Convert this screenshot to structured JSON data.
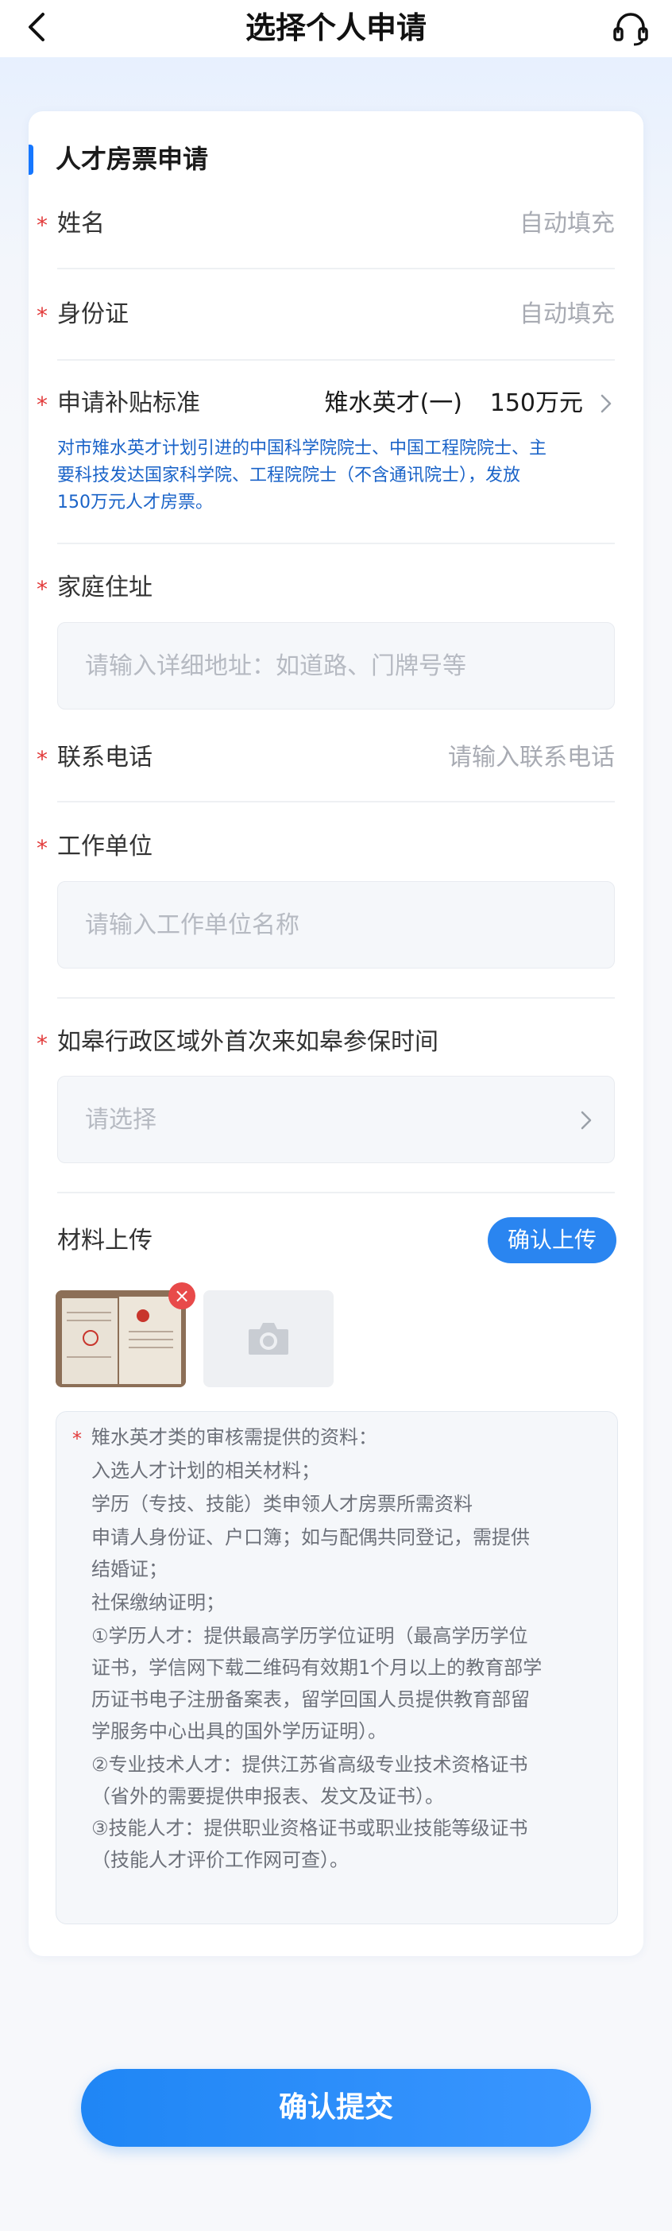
{
  "header": {
    "title": "选择个人申请",
    "back_icon": "back-chevron-icon",
    "support_icon": "headset-icon"
  },
  "form": {
    "section_title": "人才房票申请",
    "required_mark": "*",
    "name": {
      "label": "姓名",
      "value": "自动填充"
    },
    "id_card": {
      "label": "身份证",
      "value": "自动填充"
    },
    "subsidy": {
      "label": "申请补贴标准",
      "value": "雉水英才(一)",
      "amount": "150万元",
      "description_lines": [
        "对市雉水英才计划引进的中国科学院院士、中国工程院院士、主",
        "要科技发达国家科学院、工程院院士（不含通讯院士），发放",
        "150万元人才房票。"
      ]
    },
    "address": {
      "label": "家庭住址",
      "placeholder": "请输入详细地址：如道路、门牌号等"
    },
    "phone": {
      "label": "联系电话",
      "placeholder": "请输入联系电话"
    },
    "employer": {
      "label": "工作单位",
      "placeholder": "请输入工作单位名称"
    },
    "insurance_time": {
      "label": "如皋行政区域外首次来如皋参保时间",
      "placeholder": "请选择"
    },
    "materials": {
      "label": "材料上传",
      "button": "确认上传",
      "close_glyph": "×"
    },
    "notes": {
      "lines": [
        "雉水英才类的审核需提供的资料：",
        "入选人才计划的相关材料；",
        "学历（专技、技能）类申领人才房票所需资料",
        "申请人身份证、户口簿；如与配偶共同登记，需提供",
        "结婚证；",
        "社保缴纳证明；",
        "①学历人才：提供最高学历学位证明（最高学历学位",
        "证书，学信网下载二维码有效期1个月以上的教育部学",
        "历证书电子注册备案表，留学回国人员提供教育部留",
        "学服务中心出具的国外学历证明）。",
        "②专业技术人才：提供江苏省高级专业技术资格证书",
        "（省外的需要提供申报表、发文及证书）。",
        "③技能人才：提供职业资格证书或职业技能等级证书",
        "（技能人才评价工作网可查）。"
      ]
    }
  },
  "submit": {
    "label": "确认提交"
  },
  "colors": {
    "accent": "#1677ff",
    "required": "#e23b3b",
    "description": "#1a63c8"
  }
}
